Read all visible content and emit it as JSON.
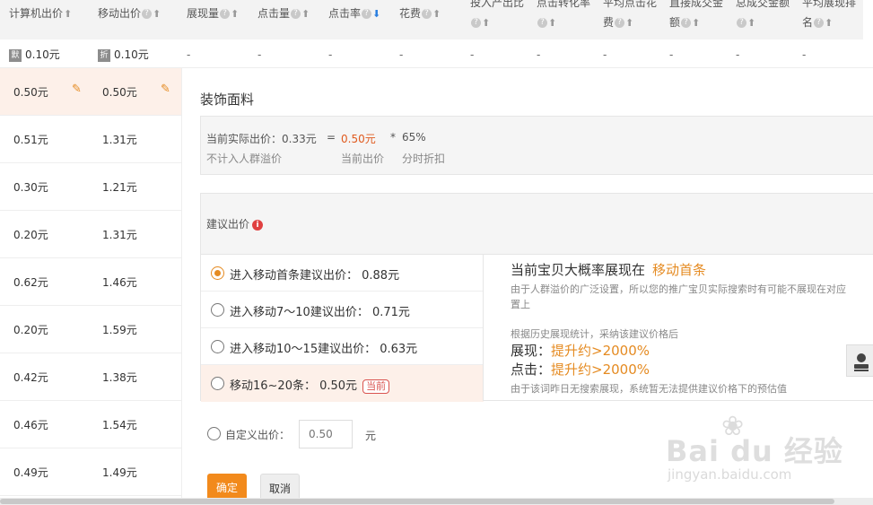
{
  "header": {
    "columns": [
      {
        "l1": "计算机出价"
      },
      {
        "l1": "移动出价"
      },
      {
        "l1": "展现量"
      },
      {
        "l1": "点击量"
      },
      {
        "l1": "点击率"
      },
      {
        "l1": "花费"
      },
      {
        "l1": "投入产出比",
        "l2": ""
      },
      {
        "l1": "点击转化率",
        "l2": ""
      },
      {
        "l1": "平均点击花",
        "l2": "费"
      },
      {
        "l1": "直接成交金",
        "l2": "额"
      },
      {
        "l1": "总成交金额",
        "l2": ""
      },
      {
        "l1": "平均展现排",
        "l2": "名"
      }
    ]
  },
  "default_row": {
    "pc_tag": "默",
    "pc_value": "0.10元",
    "mobile_tag": "折",
    "mobile_value": "0.10元",
    "dash": "-"
  },
  "rows": [
    {
      "pc": "0.50元",
      "mobile": "0.50元"
    },
    {
      "pc": "0.51元",
      "mobile": "1.31元"
    },
    {
      "pc": "0.30元",
      "mobile": "1.21元"
    },
    {
      "pc": "0.20元",
      "mobile": "1.31元"
    },
    {
      "pc": "0.62元",
      "mobile": "1.46元"
    },
    {
      "pc": "0.20元",
      "mobile": "1.59元"
    },
    {
      "pc": "0.42元",
      "mobile": "1.38元"
    },
    {
      "pc": "0.46元",
      "mobile": "1.54元"
    },
    {
      "pc": "0.49元",
      "mobile": "1.49元"
    }
  ],
  "panel": {
    "title": "装饰面料",
    "calc": {
      "actual": "当前实际出价：0.33元",
      "eq": "=",
      "current": "0.50元",
      "mul": "*",
      "pct": "65%",
      "lbl_actual": "不计入人群溢价",
      "lbl_current": "当前出价",
      "lbl_pct": "分时折扣"
    },
    "suggest_label": "建议出价",
    "info_icon": "i",
    "options": [
      {
        "text": "进入移动首条建议出价：  0.88元"
      },
      {
        "text": "进入移动7～10建议出价：  0.71元"
      },
      {
        "text": "进入移动10～15建议出价：  0.63元"
      },
      {
        "text": "移动16~20条：  0.50元",
        "badge": "当前"
      }
    ],
    "right": {
      "title": "当前宝贝大概率展现在",
      "title_hl": "移动首条",
      "note1": "由于人群溢价的广泛设置，所以您的推广宝贝实际搜索时有可能不展现在对应",
      "note1b": "置上",
      "note2": "根据历史展现统计，采纳该建议价格后",
      "show_label": "展现：",
      "show_value": "提升约>2000%",
      "click_label": "点击：",
      "click_value": "提升约>2000%",
      "note3": "由于该词昨日无搜索展现，系统暂无法提供建议价格下的预估值"
    },
    "custom": {
      "label": "自定义出价：",
      "placeholder": "0.50",
      "unit": "元"
    },
    "ok_label": "确定",
    "cancel_label": "取消"
  },
  "watermark": {
    "brand": "Bai du 经验",
    "url": "jingyan.baidu.com"
  },
  "colors": {
    "accent": "#e58b22",
    "highlight_row": "#fdf0e9",
    "confirm": "#f28a1c"
  }
}
